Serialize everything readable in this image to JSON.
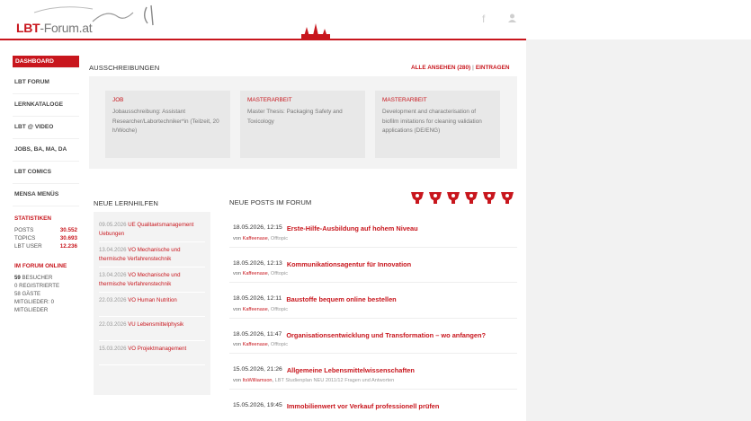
{
  "header": {
    "logo_main": "LBT",
    "logo_rest": "-Forum.at",
    "icons": [
      "facebook-icon",
      "user-icon"
    ]
  },
  "sidebar": {
    "items": [
      {
        "label": "DASHBOARD",
        "active": true
      },
      {
        "label": "LBT FORUM"
      },
      {
        "label": "LERNKATALOGE"
      },
      {
        "label": "LBT @ VIDEO"
      },
      {
        "label": "JOBS, BA, MA, DA"
      },
      {
        "label": "LBT COMICS"
      },
      {
        "label": "MENSA MENÜS"
      }
    ],
    "stats_heading": "STATISTIKEN",
    "stats": [
      {
        "label": "POSTS",
        "value": "30.552"
      },
      {
        "label": "TOPICS",
        "value": "30.693"
      },
      {
        "label": "LBT USER",
        "value": "12.236"
      }
    ],
    "online_heading": "IM FORUM ONLINE",
    "online": {
      "besucher_count": "59",
      "besucher_label": "BESUCHER",
      "registrierte": "0 REGISTRIERTE",
      "gaeste": "58 GÄSTE",
      "mitglieder": "MITGLIEDER: 0",
      "mitglieder2": "MITGLIEDER"
    }
  },
  "ausschreibungen": {
    "title": "AUSSCHREIBUNGEN",
    "all_link": "ALLE ANSEHEN (280)",
    "separator": "|",
    "post_link": "EINTRAGEN",
    "cards": [
      {
        "type": "JOB",
        "title": "Jobausschreibung: Assistant Researcher/Labortechniker*in (Teilzeit, 20 h/Woche)"
      },
      {
        "type": "MASTERARBEIT",
        "title": "Master Thesis: Packaging Safety and Toxicology"
      },
      {
        "type": "MASTERARBEIT",
        "title": "Development and characterisation of biofilm imitations for cleaning validation applications (DE/ENG)"
      }
    ]
  },
  "lernhilfen": {
    "title": "NEUE LERNHILFEN",
    "items": [
      {
        "date": "09.05.2026",
        "title": "UE Qualitaetsmanagement Uebungen"
      },
      {
        "date": "13.04.2026",
        "title": "VO Mechanische und thermische Verfahrenstechnik"
      },
      {
        "date": "13.04.2026",
        "title": "VO Mechanische und thermische Verfahrenstechnik"
      },
      {
        "date": "22.03.2026",
        "title": "VO Human Nutrition"
      },
      {
        "date": "22.03.2026",
        "title": "VU Lebensmittelphysik"
      },
      {
        "date": "15.03.2026",
        "title": "VO Projektmanagement"
      }
    ]
  },
  "posts": {
    "title": "NEUE POSTS IM FORUM",
    "trophy_count": 6,
    "von": "von",
    "items": [
      {
        "time": "18.05.2026, 12:15",
        "title": "Erste-Hilfe-Ausbildung auf hohem Niveau",
        "author": "Kaffeenase",
        "forum": "Offtopic"
      },
      {
        "time": "18.05.2026, 12:13",
        "title": "Kommunikationsagentur für Innovation",
        "author": "Kaffeenase",
        "forum": "Offtopic"
      },
      {
        "time": "18.05.2026, 12:11",
        "title": "Baustoffe bequem online bestellen",
        "author": "Kaffeenase",
        "forum": "Offtopic"
      },
      {
        "time": "18.05.2026, 11:47",
        "title": "Organisationsentwicklung und Transformation – wo anfangen?",
        "author": "Kaffeenase",
        "forum": "Offtopic"
      },
      {
        "time": "15.05.2026, 21:26",
        "title": "Allgemeine Lebensmittelwissenschaften",
        "author": "ItsWilliamson",
        "forum": "LBT Studienplan NEU 2011/12 Fragen und Antworten"
      },
      {
        "time": "15.05.2026, 19:45",
        "title": "Immobilienwert vor Verkauf professionell prüfen",
        "author": "",
        "forum": ""
      }
    ]
  },
  "colors": {
    "accent": "#c8161d",
    "panel": "#f3f3f3",
    "card": "#e8e8e8"
  }
}
